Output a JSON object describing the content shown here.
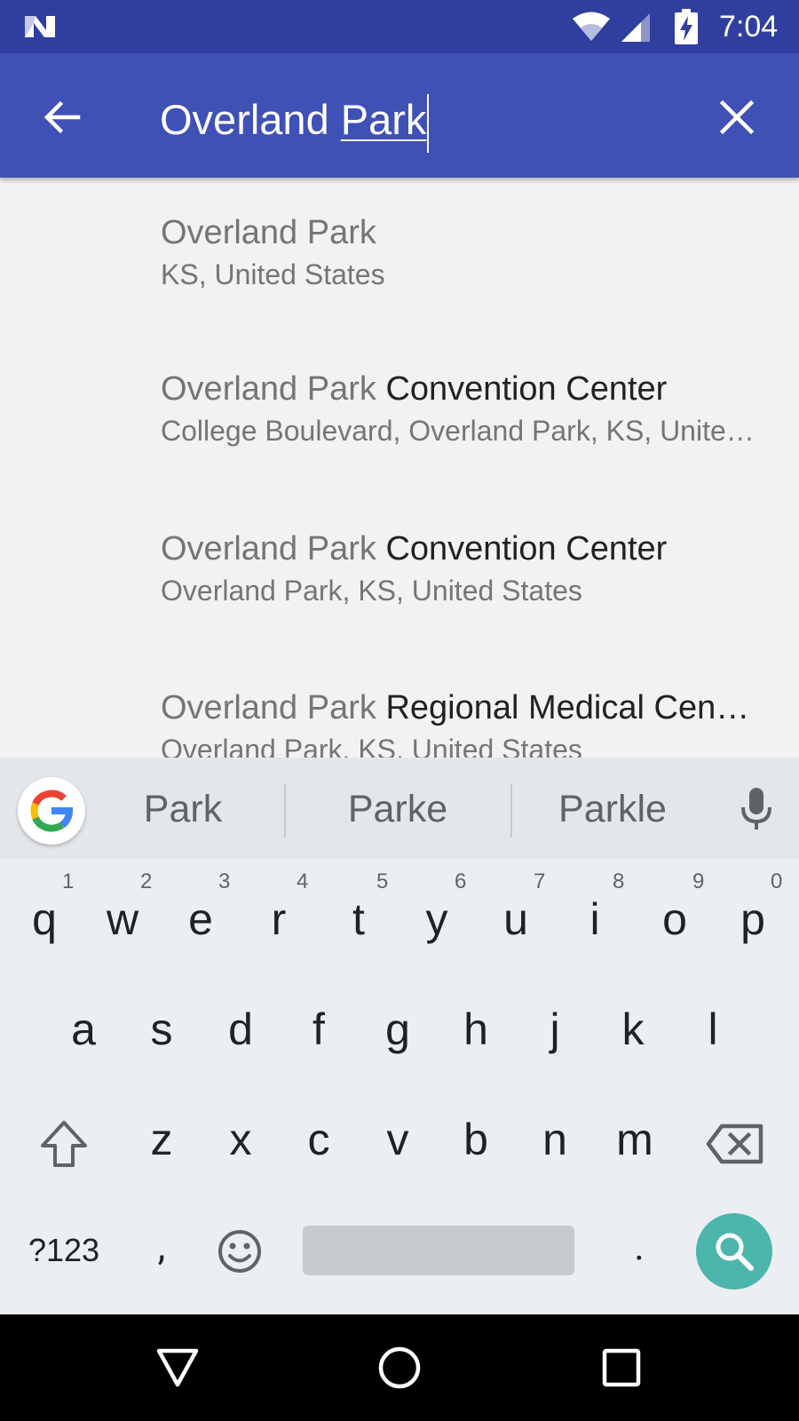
{
  "status_bar": {
    "time": "7:04",
    "icons": [
      "nougat-logo-icon",
      "wifi-icon",
      "cell-signal-icon",
      "battery-charging-icon"
    ]
  },
  "search_bar": {
    "query_prefix": "Overland ",
    "query_composing": "Park",
    "icons": [
      "back-arrow-icon",
      "close-icon"
    ]
  },
  "results": [
    {
      "match": "Overland Park",
      "rest": "",
      "secondary": "KS, United States"
    },
    {
      "match": "Overland Park",
      "rest": " Convention Center",
      "secondary": "College Boulevard, Overland Park, KS, United States"
    },
    {
      "match": "Overland Park",
      "rest": " Convention Center",
      "secondary": "Overland Park, KS, United States"
    },
    {
      "match": "Overland Park",
      "rest": " Regional Medical Cen…",
      "secondary": "Overland Park, KS, United States"
    }
  ],
  "keyboard": {
    "suggestions": [
      "Park",
      "Parke",
      "Parkle"
    ],
    "row1": [
      "q",
      "w",
      "e",
      "r",
      "t",
      "y",
      "u",
      "i",
      "o",
      "p"
    ],
    "row1_hints": [
      "1",
      "2",
      "3",
      "4",
      "5",
      "6",
      "7",
      "8",
      "9",
      "0"
    ],
    "row2": [
      "a",
      "s",
      "d",
      "f",
      "g",
      "h",
      "j",
      "k",
      "l"
    ],
    "row3": [
      "z",
      "x",
      "c",
      "v",
      "b",
      "n",
      "m"
    ],
    "symbols_label": "?123",
    "comma_label": ",",
    "period_label": ".",
    "accent_color": "#4db6ac",
    "icons": [
      "google-g-icon",
      "mic-icon",
      "shift-icon",
      "backspace-icon",
      "emoji-icon",
      "search-icon"
    ]
  },
  "nav_bar": {
    "icons": [
      "back-triangle-icon",
      "home-circle-icon",
      "recents-square-icon"
    ]
  },
  "colors": {
    "primary": "#3f51b5",
    "primary_dark": "#303f9f"
  }
}
